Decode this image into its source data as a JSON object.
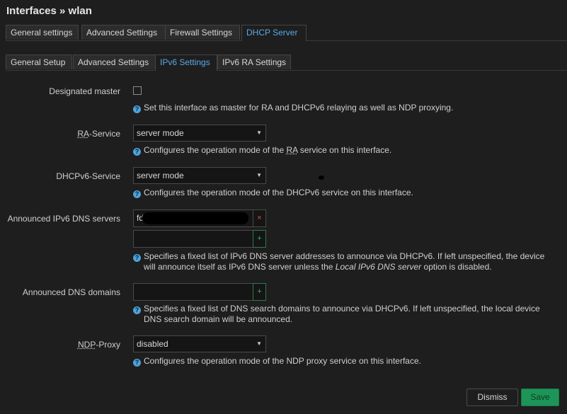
{
  "header": {
    "title": "Interfaces » wlan"
  },
  "outer_tabs": [
    {
      "label": "General settings"
    },
    {
      "label": "Advanced Settings"
    },
    {
      "label": "Firewall Settings"
    },
    {
      "label": "DHCP Server"
    }
  ],
  "inner_tabs": [
    {
      "label": "General Setup"
    },
    {
      "label": "Advanced Settings"
    },
    {
      "label": "IPv6 Settings"
    },
    {
      "label": "IPv6 RA Settings"
    }
  ],
  "fields": {
    "designated_master": {
      "label": "Designated master",
      "checked": false,
      "help": "Set this interface as master for RA and DHCPv6 relaying as well as NDP proxying."
    },
    "ra_service": {
      "label_abbr": "RA",
      "label_rest": "-Service",
      "value": "server mode",
      "help_pre": "Configures the operation mode of the ",
      "help_abbr": "RA",
      "help_post": " service on this interface."
    },
    "dhcpv6_service": {
      "label": "DHCPv6-Service",
      "value": "server mode",
      "help": "Configures the operation mode of the DHCPv6 service on this interface."
    },
    "dns_servers": {
      "label": "Announced IPv6 DNS servers",
      "value": "fd",
      "add_placeholder": "",
      "help_line1": "Specifies a fixed list of IPv6 DNS server addresses to announce via DHCPv6. If left unspecified, the device",
      "help_line2_pre": "will announce itself as IPv6 DNS server unless the ",
      "help_line2_em": "Local IPv6 DNS server",
      "help_line2_post": " option is disabled."
    },
    "dns_domains": {
      "label": "Announced DNS domains",
      "value": "",
      "help_line1": "Specifies a fixed list of DNS search domains to announce via DHCPv6. If left unspecified, the local device",
      "help_line2": "DNS search domain will be announced."
    },
    "ndp_proxy": {
      "label_abbr": "NDP",
      "label_rest": "-Proxy",
      "value": "disabled",
      "help": "Configures the operation mode of the NDP proxy service on this interface."
    }
  },
  "icons": {
    "help": "?",
    "delete": "×",
    "add": "+",
    "caret": "▼"
  },
  "footer": {
    "dismiss_label": "Dismiss",
    "save_label": "Save"
  },
  "colors": {
    "accent": "#5aa8e6",
    "save": "#1e9558",
    "delete": "#e05050",
    "add": "#35b36b"
  }
}
